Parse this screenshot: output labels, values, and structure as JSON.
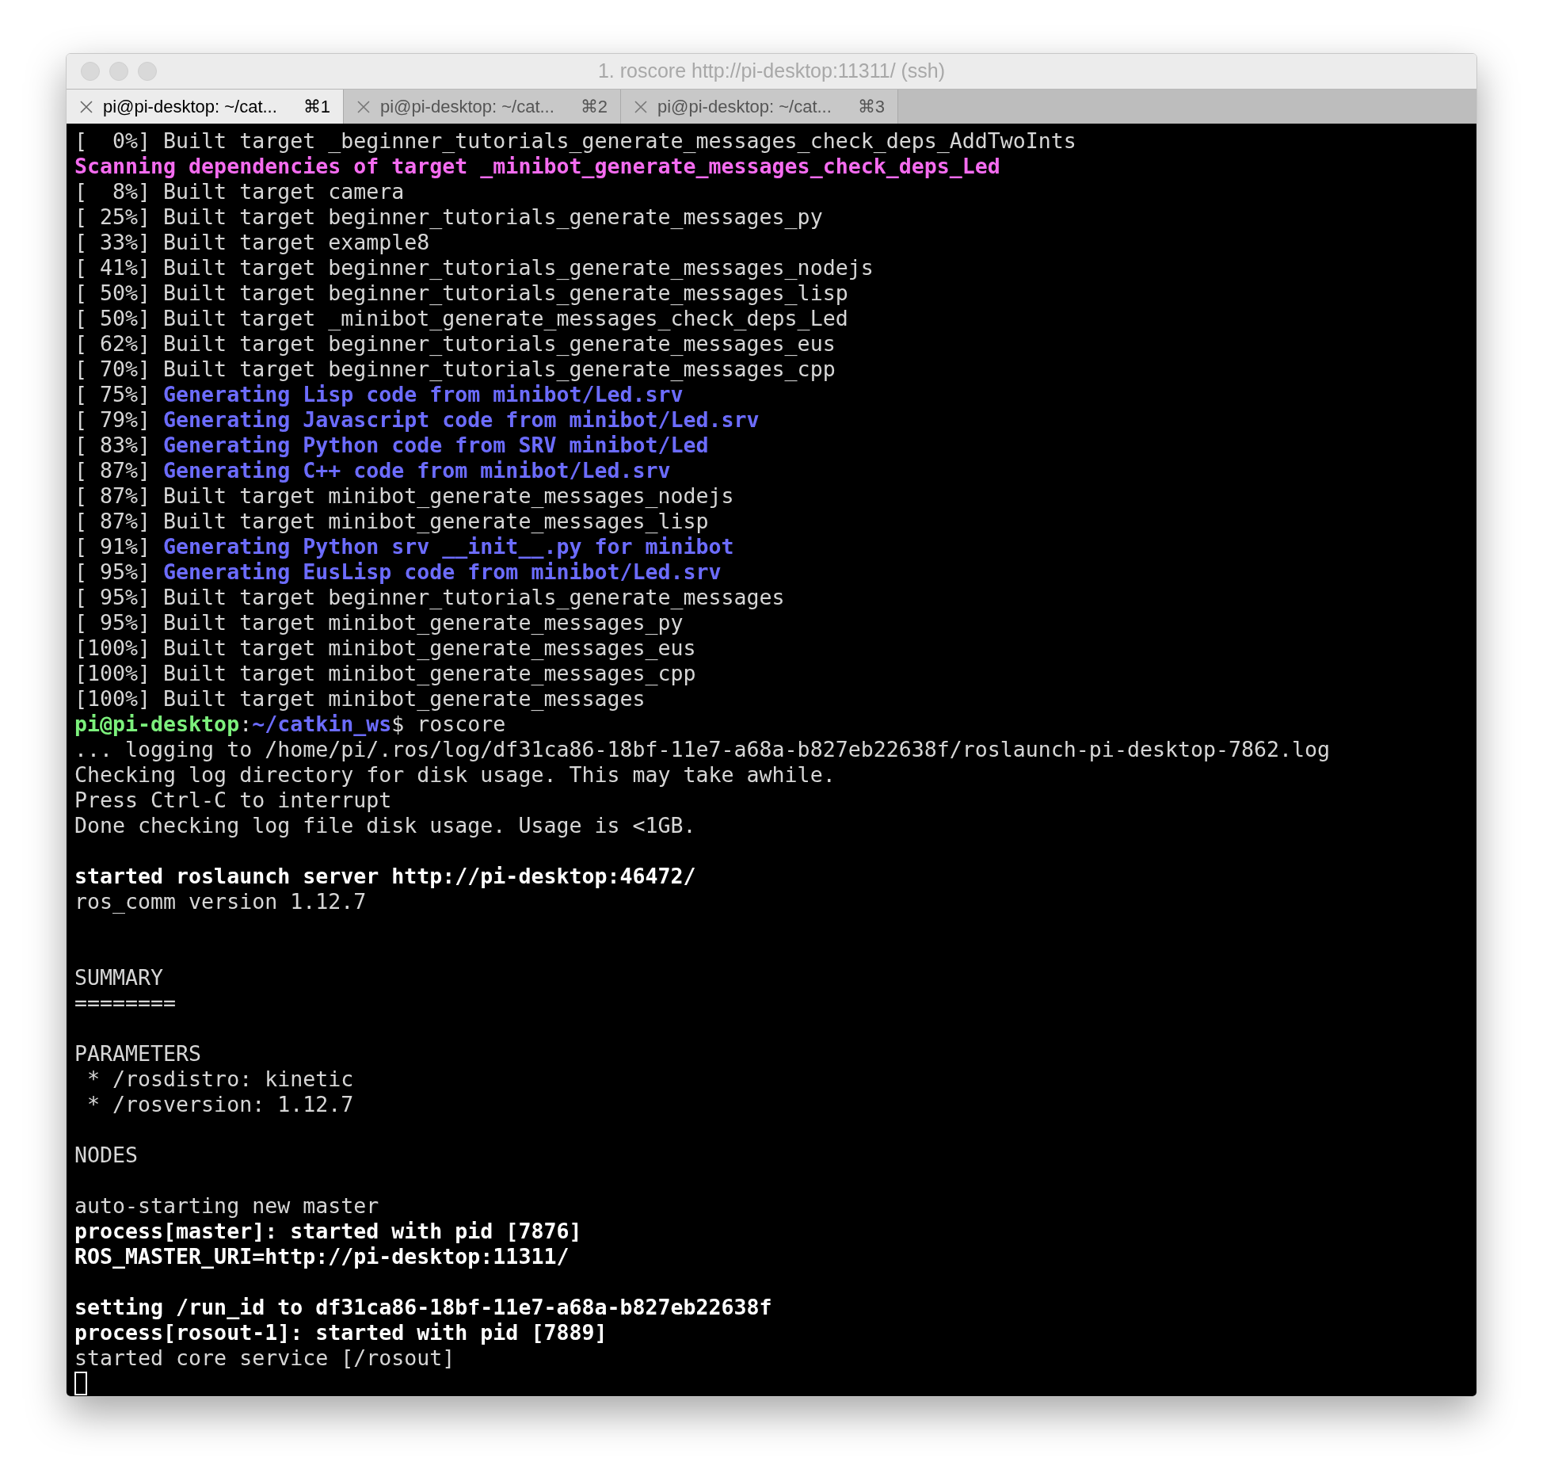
{
  "window": {
    "title": "1. roscore http://pi-desktop:11311/ (ssh)"
  },
  "tabs": [
    {
      "label": "pi@pi-desktop: ~/cat...",
      "shortcut": "⌘1",
      "selected": true
    },
    {
      "label": "pi@pi-desktop: ~/cat...",
      "shortcut": "⌘2",
      "selected": false
    },
    {
      "label": "pi@pi-desktop: ~/cat...",
      "shortcut": "⌘3",
      "selected": false
    }
  ],
  "terminal": {
    "lines": [
      {
        "spans": [
          {
            "kind": "plain",
            "text": "[  0%] Built target _beginner_tutorials_generate_messages_check_deps_AddTwoInts"
          }
        ]
      },
      {
        "spans": [
          {
            "kind": "pink",
            "text": "Scanning dependencies of target _minibot_generate_messages_check_deps_Led"
          }
        ]
      },
      {
        "spans": [
          {
            "kind": "plain",
            "text": "[  8%] Built target camera"
          }
        ]
      },
      {
        "spans": [
          {
            "kind": "plain",
            "text": "[ 25%] Built target beginner_tutorials_generate_messages_py"
          }
        ]
      },
      {
        "spans": [
          {
            "kind": "plain",
            "text": "[ 33%] Built target example8"
          }
        ]
      },
      {
        "spans": [
          {
            "kind": "plain",
            "text": "[ 41%] Built target beginner_tutorials_generate_messages_nodejs"
          }
        ]
      },
      {
        "spans": [
          {
            "kind": "plain",
            "text": "[ 50%] Built target beginner_tutorials_generate_messages_lisp"
          }
        ]
      },
      {
        "spans": [
          {
            "kind": "plain",
            "text": "[ 50%] Built target _minibot_generate_messages_check_deps_Led"
          }
        ]
      },
      {
        "spans": [
          {
            "kind": "plain",
            "text": "[ 62%] Built target beginner_tutorials_generate_messages_eus"
          }
        ]
      },
      {
        "spans": [
          {
            "kind": "plain",
            "text": "[ 70%] Built target beginner_tutorials_generate_messages_cpp"
          }
        ]
      },
      {
        "spans": [
          {
            "kind": "plain",
            "text": "[ 75%] "
          },
          {
            "kind": "blue",
            "text": "Generating Lisp code from minibot/Led.srv"
          }
        ]
      },
      {
        "spans": [
          {
            "kind": "plain",
            "text": "[ 79%] "
          },
          {
            "kind": "blue",
            "text": "Generating Javascript code from minibot/Led.srv"
          }
        ]
      },
      {
        "spans": [
          {
            "kind": "plain",
            "text": "[ 83%] "
          },
          {
            "kind": "blue",
            "text": "Generating Python code from SRV minibot/Led"
          }
        ]
      },
      {
        "spans": [
          {
            "kind": "plain",
            "text": "[ 87%] "
          },
          {
            "kind": "blue",
            "text": "Generating C++ code from minibot/Led.srv"
          }
        ]
      },
      {
        "spans": [
          {
            "kind": "plain",
            "text": "[ 87%] Built target minibot_generate_messages_nodejs"
          }
        ]
      },
      {
        "spans": [
          {
            "kind": "plain",
            "text": "[ 87%] Built target minibot_generate_messages_lisp"
          }
        ]
      },
      {
        "spans": [
          {
            "kind": "plain",
            "text": "[ 91%] "
          },
          {
            "kind": "blue",
            "text": "Generating Python srv __init__.py for minibot"
          }
        ]
      },
      {
        "spans": [
          {
            "kind": "plain",
            "text": "[ 95%] "
          },
          {
            "kind": "blue",
            "text": "Generating EusLisp code from minibot/Led.srv"
          }
        ]
      },
      {
        "spans": [
          {
            "kind": "plain",
            "text": "[ 95%] Built target beginner_tutorials_generate_messages"
          }
        ]
      },
      {
        "spans": [
          {
            "kind": "plain",
            "text": "[ 95%] Built target minibot_generate_messages_py"
          }
        ]
      },
      {
        "spans": [
          {
            "kind": "plain",
            "text": "[100%] Built target minibot_generate_messages_eus"
          }
        ]
      },
      {
        "spans": [
          {
            "kind": "plain",
            "text": "[100%] Built target minibot_generate_messages_cpp"
          }
        ]
      },
      {
        "spans": [
          {
            "kind": "plain",
            "text": "[100%] Built target minibot_generate_messages"
          }
        ]
      },
      {
        "spans": [
          {
            "kind": "user",
            "text": "pi@pi-desktop"
          },
          {
            "kind": "plain",
            "text": ":"
          },
          {
            "kind": "path",
            "text": "~/catkin_ws"
          },
          {
            "kind": "plain",
            "text": "$ roscore"
          }
        ]
      },
      {
        "spans": [
          {
            "kind": "plain",
            "text": "... logging to /home/pi/.ros/log/df31ca86-18bf-11e7-a68a-b827eb22638f/roslaunch-pi-desktop-7862.log"
          }
        ]
      },
      {
        "spans": [
          {
            "kind": "plain",
            "text": "Checking log directory for disk usage. This may take awhile."
          }
        ]
      },
      {
        "spans": [
          {
            "kind": "plain",
            "text": "Press Ctrl-C to interrupt"
          }
        ]
      },
      {
        "spans": [
          {
            "kind": "plain",
            "text": "Done checking log file disk usage. Usage is <1GB."
          }
        ]
      },
      {
        "kind": "blank"
      },
      {
        "spans": [
          {
            "kind": "bold",
            "text": "started roslaunch server http://pi-desktop:46472/"
          }
        ]
      },
      {
        "spans": [
          {
            "kind": "plain",
            "text": "ros_comm version 1.12.7"
          }
        ]
      },
      {
        "kind": "blank"
      },
      {
        "kind": "blank"
      },
      {
        "spans": [
          {
            "kind": "plain",
            "text": "SUMMARY"
          }
        ]
      },
      {
        "spans": [
          {
            "kind": "plain",
            "text": "========"
          }
        ]
      },
      {
        "kind": "blank"
      },
      {
        "spans": [
          {
            "kind": "plain",
            "text": "PARAMETERS"
          }
        ]
      },
      {
        "spans": [
          {
            "kind": "plain",
            "text": " * /rosdistro: kinetic"
          }
        ]
      },
      {
        "spans": [
          {
            "kind": "plain",
            "text": " * /rosversion: 1.12.7"
          }
        ]
      },
      {
        "kind": "blank"
      },
      {
        "spans": [
          {
            "kind": "plain",
            "text": "NODES"
          }
        ]
      },
      {
        "kind": "blank"
      },
      {
        "spans": [
          {
            "kind": "plain",
            "text": "auto-starting new master"
          }
        ]
      },
      {
        "spans": [
          {
            "kind": "bold",
            "text": "process[master]: started with pid [7876]"
          }
        ]
      },
      {
        "spans": [
          {
            "kind": "bold",
            "text": "ROS_MASTER_URI=http://pi-desktop:11311/"
          }
        ]
      },
      {
        "kind": "blank"
      },
      {
        "spans": [
          {
            "kind": "bold",
            "text": "setting /run_id to df31ca86-18bf-11e7-a68a-b827eb22638f"
          }
        ]
      },
      {
        "spans": [
          {
            "kind": "bold",
            "text": "process[rosout-1]: started with pid [7889]"
          }
        ]
      },
      {
        "spans": [
          {
            "kind": "plain",
            "text": "started core service [/rosout]"
          }
        ]
      }
    ],
    "cursor": true
  }
}
